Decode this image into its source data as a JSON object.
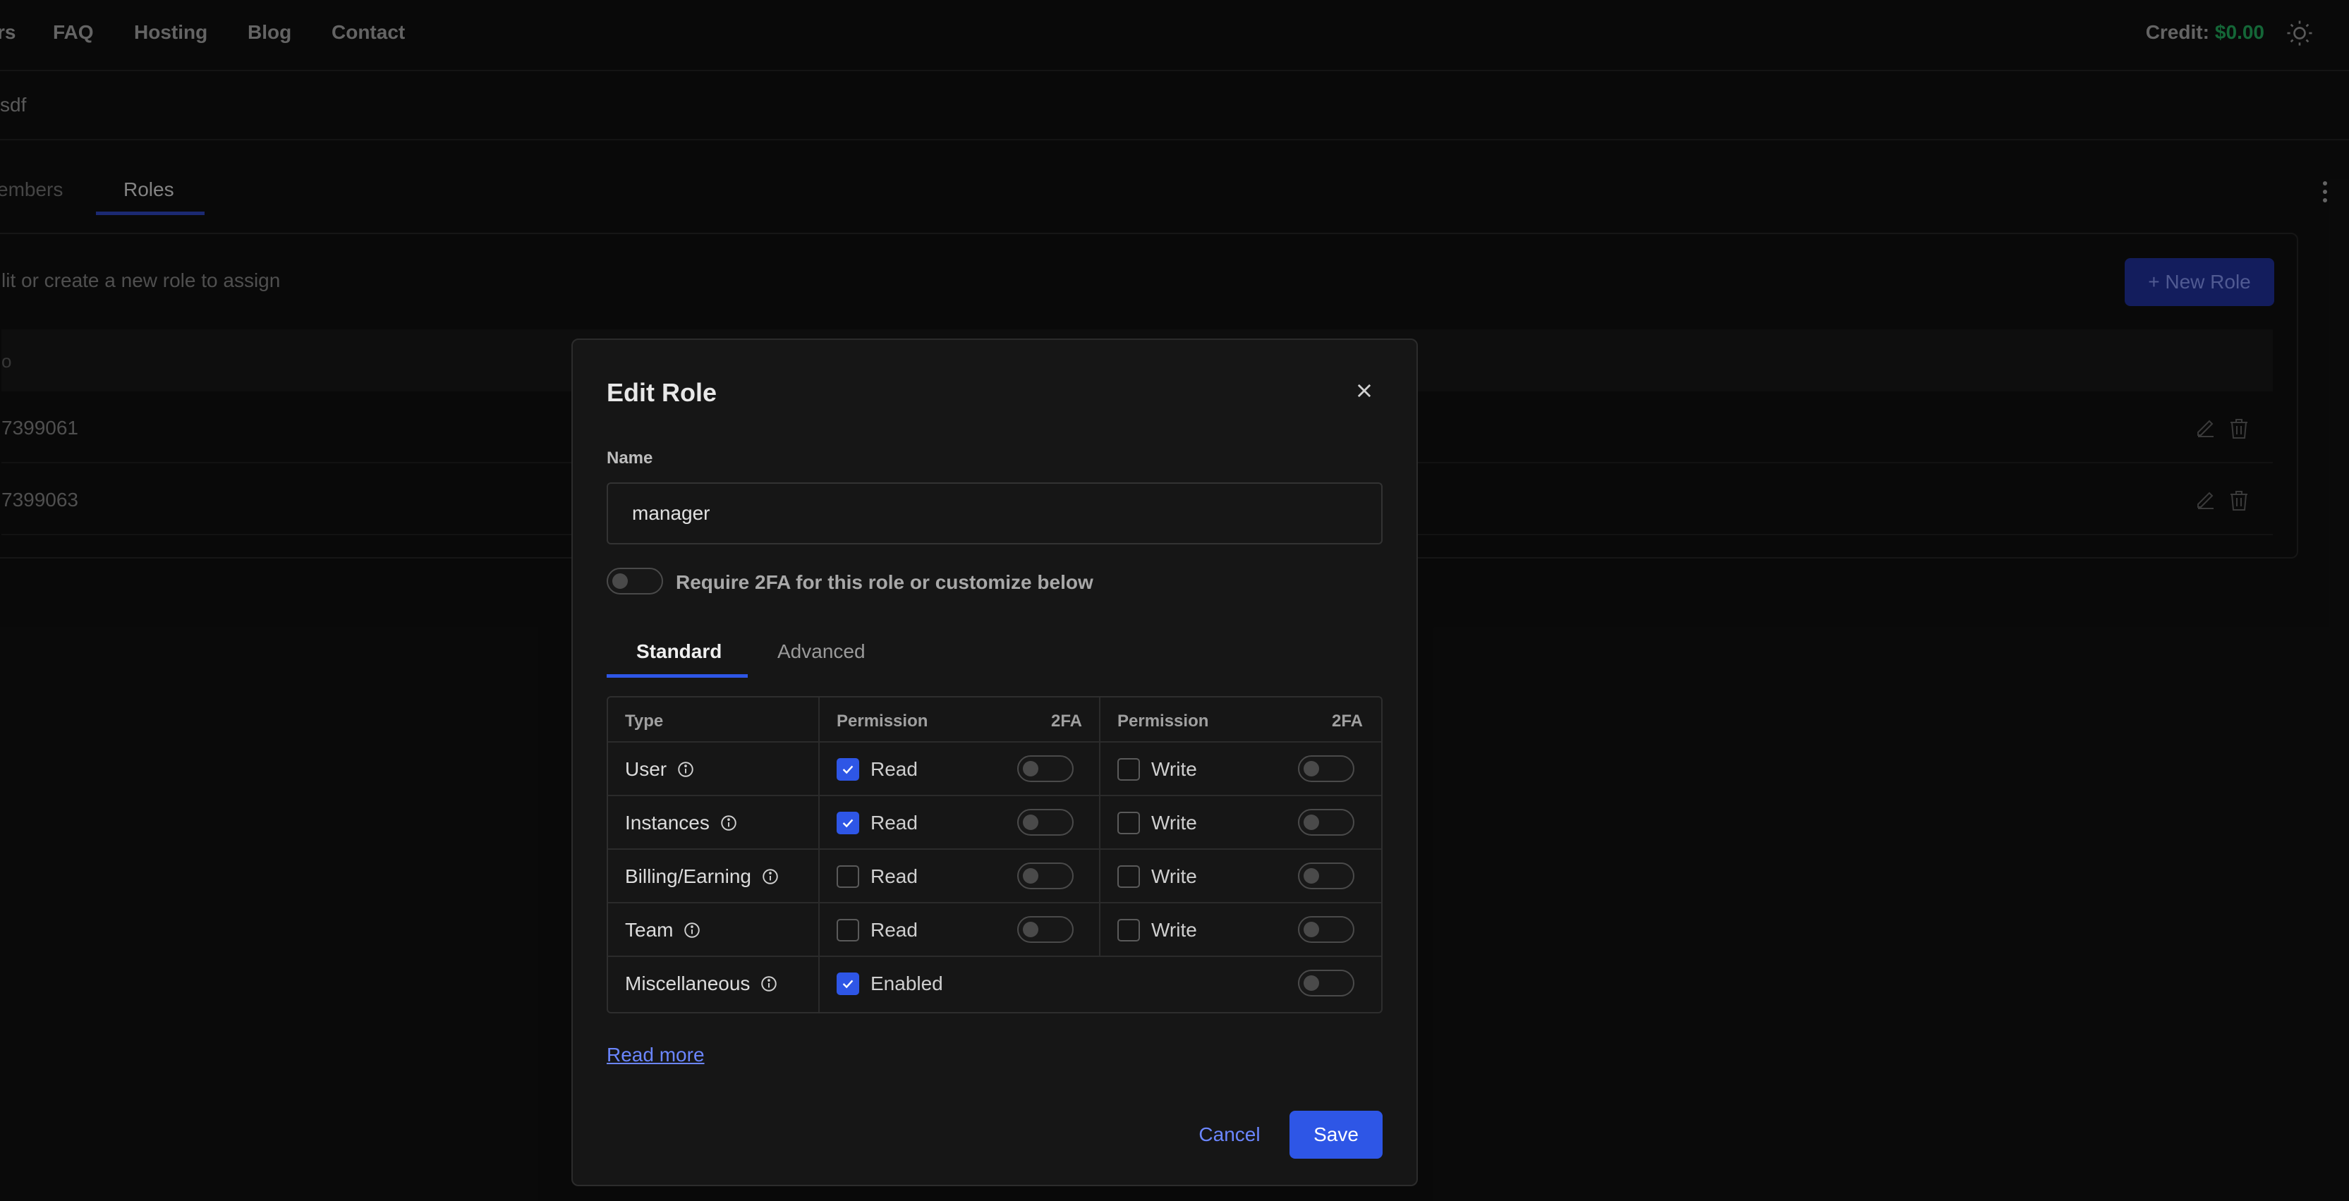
{
  "nav": {
    "items": [
      "rs",
      "FAQ",
      "Hosting",
      "Blog",
      "Contact"
    ],
    "credit_label": "Credit:",
    "credit_value": "$0.00"
  },
  "subbar": {
    "crumb": "sdf"
  },
  "page_tabs": {
    "members": "embers",
    "roles": "Roles"
  },
  "panel": {
    "description": "lit or create a new role to assign",
    "new_role_label": "+ New Role",
    "table_header": "o",
    "rows": [
      "7399061",
      "7399063"
    ]
  },
  "modal": {
    "title": "Edit Role",
    "name_label": "Name",
    "name_value": "manager",
    "require_2fa_label": "Require 2FA for this role or customize below",
    "tabs": {
      "standard": "Standard",
      "advanced": "Advanced"
    },
    "table": {
      "headers": {
        "type": "Type",
        "permission": "Permission",
        "twofa": "2FA"
      },
      "rows": [
        {
          "type": "User",
          "read": "Read",
          "read_checked": true,
          "write": "Write",
          "write_checked": false
        },
        {
          "type": "Instances",
          "read": "Read",
          "read_checked": true,
          "write": "Write",
          "write_checked": false
        },
        {
          "type": "Billing/Earning",
          "read": "Read",
          "read_checked": false,
          "write": "Write",
          "write_checked": false
        },
        {
          "type": "Team",
          "read": "Read",
          "read_checked": false,
          "write": "Write",
          "write_checked": false
        }
      ],
      "misc": {
        "type": "Miscellaneous",
        "label": "Enabled",
        "checked": true
      }
    },
    "read_more": "Read more",
    "cancel": "Cancel",
    "save": "Save"
  },
  "colors": {
    "accent": "#2e56e6",
    "credit": "#1f9d55",
    "link": "#6b86ff"
  }
}
